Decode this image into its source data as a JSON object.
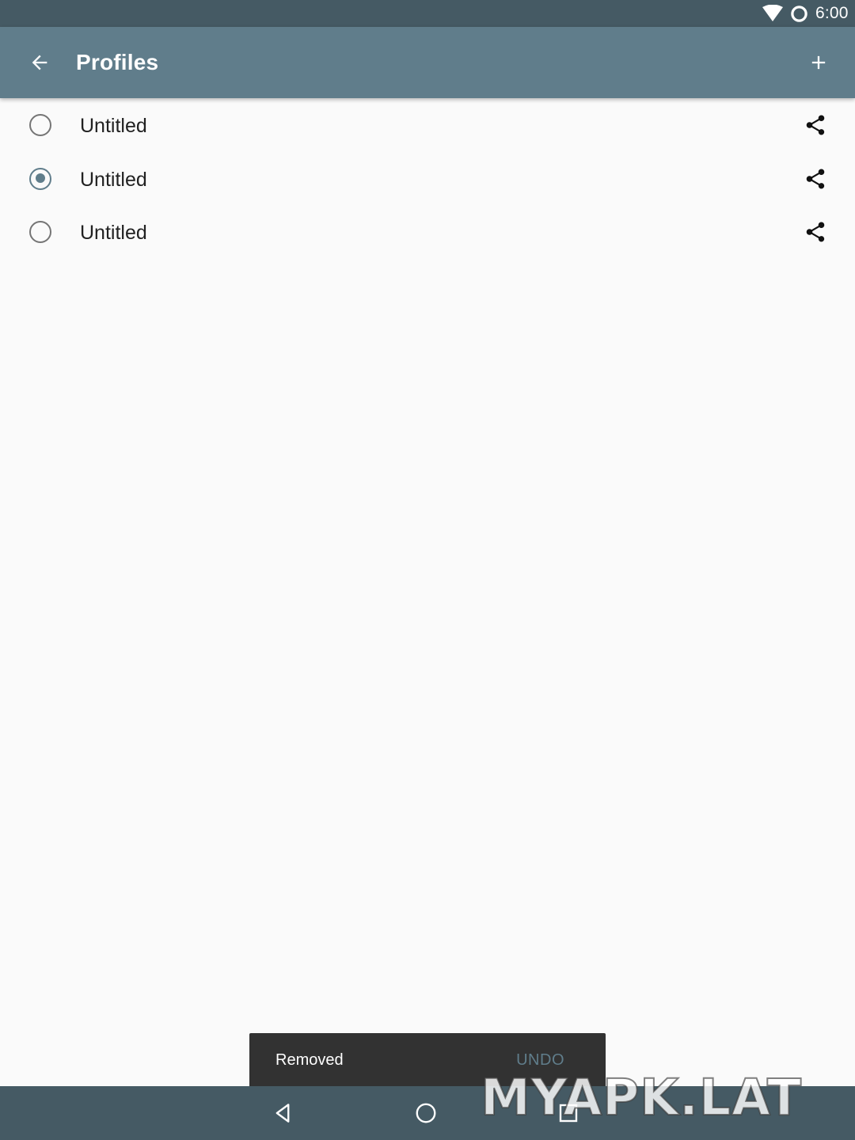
{
  "status_bar": {
    "time": "6:00",
    "icons": [
      "wifi-icon",
      "sync-ring-icon"
    ]
  },
  "app_bar": {
    "title": "Profiles",
    "back_icon": "arrow-back-icon",
    "add_icon": "plus-icon",
    "background_color": "#607d8b"
  },
  "profiles": [
    {
      "label": "Untitled",
      "selected": false
    },
    {
      "label": "Untitled",
      "selected": true
    },
    {
      "label": "Untitled",
      "selected": false
    }
  ],
  "snackbar": {
    "message": "Removed",
    "action": "UNDO"
  },
  "nav_bar": {
    "buttons": [
      "back-triangle-icon",
      "home-circle-icon",
      "recents-square-icon"
    ]
  },
  "watermark": "MYAPK.LAT",
  "colors": {
    "primary": "#607d8b",
    "primary_dark": "#455a64",
    "background": "#fafafa"
  }
}
